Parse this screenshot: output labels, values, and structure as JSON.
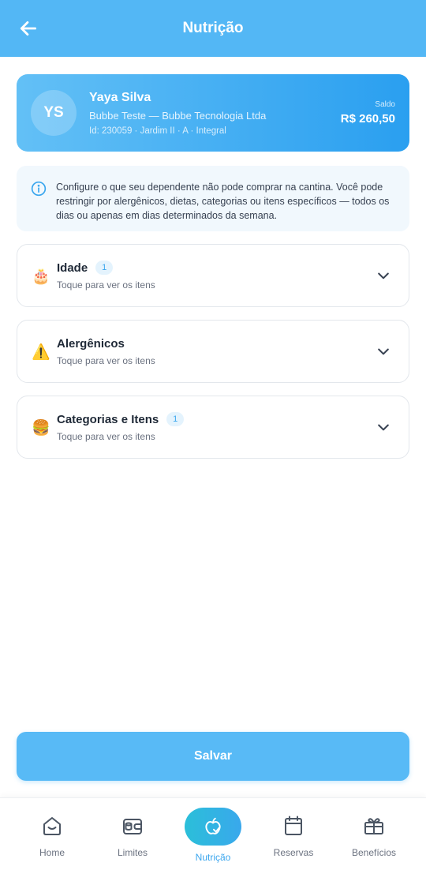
{
  "header": {
    "title": "Nutrição",
    "back_icon": "arrow-left-icon"
  },
  "profile": {
    "initials": "YS",
    "name": "Yaya Silva",
    "company": "Bubbe Teste — Bubbe Tecnologia Ltda",
    "meta": "Id: 230059 · Jardim II · A · Integral",
    "balance_label": "Saldo",
    "balance_value": "R$ 260,50"
  },
  "info": {
    "icon": "info-icon",
    "text": "Configure o que seu dependente não pode comprar na cantina. Você pode restringir por alergênicos, dietas, categorias ou itens específicos — todos os dias ou apenas em dias determinados da semana."
  },
  "sections": [
    {
      "emoji": "🎂",
      "icon": "cake-icon",
      "title": "Idade",
      "badge": "1",
      "subtitle": "Toque para ver os itens"
    },
    {
      "emoji": "⚠️",
      "icon": "warning-icon",
      "title": "Alergênicos",
      "badge": "",
      "subtitle": "Toque para ver os itens"
    },
    {
      "emoji": "🍔",
      "icon": "burger-icon",
      "title": "Categorias e Itens",
      "badge": "1",
      "subtitle": "Toque para ver os itens"
    }
  ],
  "save_label": "Salvar",
  "nav": {
    "items": [
      {
        "label": "Home",
        "icon": "home-icon",
        "active": false
      },
      {
        "label": "Limites",
        "icon": "wallet-icon",
        "active": false
      },
      {
        "label": "Nutrição",
        "icon": "apple-icon",
        "active": true
      },
      {
        "label": "Reservas",
        "icon": "calendar-icon",
        "active": false
      },
      {
        "label": "Benefícios",
        "icon": "gift-icon",
        "active": false
      }
    ]
  },
  "colors": {
    "primary": "#53b7f5",
    "accent_text": "#3aa6ee",
    "nav_active_start": "#2bbfd9"
  }
}
